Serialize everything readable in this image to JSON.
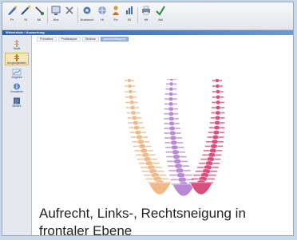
{
  "toolbar": {
    "items": [
      {
        "icon": "pen-icon",
        "label": "Pr"
      },
      {
        "icon": "wand-icon",
        "label": "St"
      },
      {
        "icon": "measure-icon",
        "label": "Mi"
      },
      {
        "icon": "monitor-icon",
        "label": "Ans"
      },
      {
        "icon": "close-icon",
        "label": ""
      },
      {
        "icon": "gear-icon",
        "label": "Ausbruch"
      },
      {
        "icon": "globe-icon",
        "label": "Hi"
      },
      {
        "icon": "person-icon",
        "label": "Pa"
      },
      {
        "icon": "bars-icon",
        "label": "BI"
      },
      {
        "icon": "printer-icon",
        "label": "Hil"
      },
      {
        "icon": "check-icon",
        "label": "Abl"
      }
    ]
  },
  "window": {
    "title": "Wirbelsäule / Auswertung"
  },
  "sidebar": {
    "items": [
      {
        "label": "Statik",
        "active": false
      },
      {
        "label": "Ausgangsdaten",
        "active": true
      },
      {
        "label": "Vergleich",
        "active": false
      },
      {
        "label": "Zusatzinfo",
        "active": false
      },
      {
        "label": "Bericht",
        "active": false
      }
    ]
  },
  "tabs": [
    {
      "label": "Frontalbus",
      "active": false
    },
    {
      "label": "Profilanalyse",
      "active": false
    },
    {
      "label": "Skoliose",
      "active": false
    },
    {
      "label": "Aufrecht/Neigung",
      "active": true
    }
  ],
  "caption": {
    "line1": "Aufrecht, Links-, Rechtsneigung in",
    "line2": "frontaler Ebene"
  },
  "colors": {
    "spine_upright": "#f0b98a",
    "spine_left": "#b98bd4",
    "spine_right": "#d9507e",
    "accent": "#2d5fa8"
  }
}
